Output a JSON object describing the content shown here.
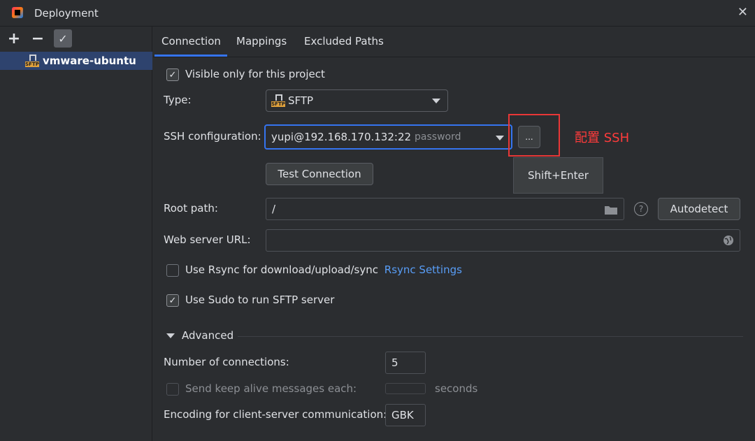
{
  "window": {
    "title": "Deployment"
  },
  "sidebar": {
    "add_label": "+",
    "remove_label": "−",
    "apply_label": "✓",
    "items": [
      {
        "label": "vmware-ubuntu",
        "icon": "sftp-server-icon"
      }
    ]
  },
  "tabs": [
    {
      "label": "Connection",
      "active": true
    },
    {
      "label": "Mappings",
      "active": false
    },
    {
      "label": "Excluded Paths",
      "active": false
    }
  ],
  "connection": {
    "visible_only_label": "Visible only for this project",
    "visible_only_checked": true,
    "type_label": "Type:",
    "type_value": "SFTP",
    "ssh_label": "SSH configuration:",
    "ssh_value": "yupi@192.168.170.132:22",
    "ssh_auth": "password",
    "browse_label": "...",
    "tooltip": "Shift+Enter",
    "annotation": "配置 SSH",
    "test_button": "Test Connection",
    "root_path_label": "Root path:",
    "root_path_value": "/",
    "autodetect_button": "Autodetect",
    "help_label": "?",
    "web_url_label": "Web server URL:",
    "web_url_value": "",
    "rsync_label": "Use Rsync for download/upload/sync",
    "rsync_checked": false,
    "rsync_settings_link": "Rsync Settings",
    "sudo_label": "Use Sudo to run SFTP server",
    "sudo_checked": true,
    "advanced_label": "Advanced",
    "connections_label": "Number of connections:",
    "connections_value": "5",
    "keep_alive_label": "Send keep alive messages each:",
    "keep_alive_value": "",
    "keep_alive_unit": "seconds",
    "encoding_label": "Encoding for client-server communication:",
    "encoding_value": "GBK"
  },
  "colors": {
    "accent": "#3574f0",
    "selection": "#2e436e",
    "annotation": "#ff3b3b",
    "link": "#589df6"
  }
}
